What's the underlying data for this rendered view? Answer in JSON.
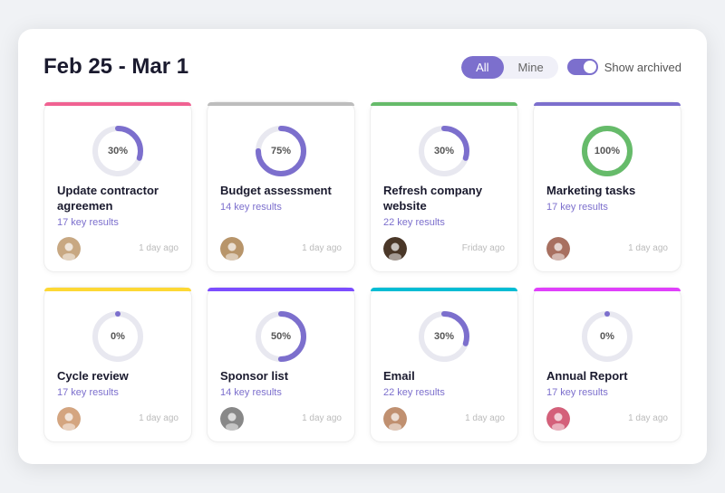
{
  "header": {
    "title": "Feb 25 - Mar 1",
    "filter": {
      "all_label": "All",
      "mine_label": "Mine"
    },
    "toggle_label": "Show archived"
  },
  "cards": [
    {
      "id": "card-1",
      "border_color": "#f06292",
      "progress": 30,
      "title": "Update contractor agreemen",
      "key_results": "17 key results",
      "time": "1 day ago",
      "avatar_class": "face-1",
      "donut_color": "#7c6fcd"
    },
    {
      "id": "card-2",
      "border_color": "#bdbdbd",
      "progress": 75,
      "title": "Budget assessment",
      "key_results": "14 key results",
      "time": "1 day ago",
      "avatar_class": "face-2",
      "donut_color": "#7c6fcd"
    },
    {
      "id": "card-3",
      "border_color": "#66bb6a",
      "progress": 30,
      "title": "Refresh company website",
      "key_results": "22 key results",
      "time": "Friday ago",
      "avatar_class": "face-3",
      "donut_color": "#7c6fcd"
    },
    {
      "id": "card-4",
      "border_color": "#7c6fcd",
      "progress": 100,
      "title": "Marketing tasks",
      "key_results": "17 key results",
      "time": "1 day ago",
      "avatar_class": "face-4",
      "donut_color": "#66bb6a"
    },
    {
      "id": "card-5",
      "border_color": "#fdd835",
      "progress": 0,
      "title": "Cycle review",
      "key_results": "17 key results",
      "time": "1 day ago",
      "avatar_class": "face-5",
      "donut_color": "#7c6fcd"
    },
    {
      "id": "card-6",
      "border_color": "#7c4dff",
      "progress": 50,
      "title": "Sponsor list",
      "key_results": "14 key results",
      "time": "1 day ago",
      "avatar_class": "face-6",
      "donut_color": "#7c6fcd"
    },
    {
      "id": "card-7",
      "border_color": "#00bcd4",
      "progress": 30,
      "title": "Email",
      "key_results": "22 key results",
      "time": "1 day ago",
      "avatar_class": "face-7",
      "donut_color": "#7c6fcd"
    },
    {
      "id": "card-8",
      "border_color": "#e040fb",
      "progress": 0,
      "title": "Annual Report",
      "key_results": "17 key results",
      "time": "1 day ago",
      "avatar_class": "face-8",
      "donut_color": "#7c6fcd"
    }
  ]
}
